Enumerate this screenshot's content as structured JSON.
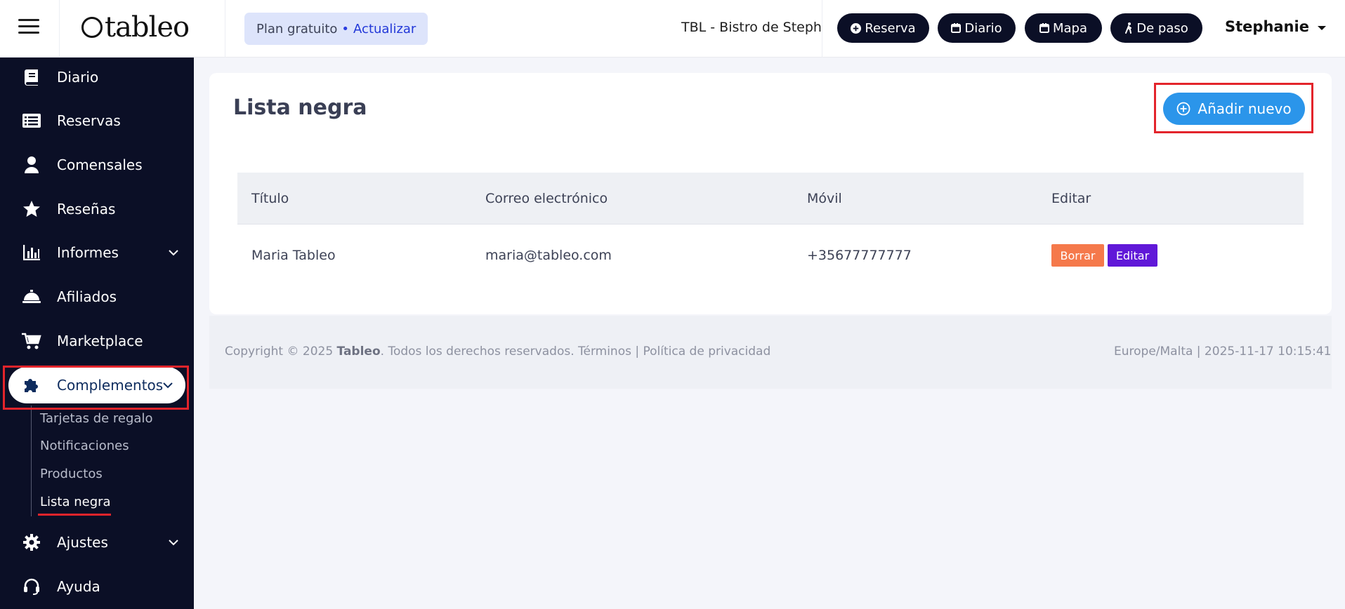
{
  "header": {
    "logo_text": "tableo",
    "plan": {
      "label": "Plan gratuito",
      "separator": "•",
      "upgrade_link": "Actualizar"
    },
    "restaurant": "TBL - Bistro de Steph",
    "quick_actions": [
      {
        "label": "Reserva",
        "icon": "plus-circle-icon"
      },
      {
        "label": "Diario",
        "icon": "calendar-icon"
      },
      {
        "label": "Mapa",
        "icon": "calendar-icon"
      },
      {
        "label": "De paso",
        "icon": "walking-icon"
      }
    ],
    "user": "Stephanie"
  },
  "sidebar": {
    "items": [
      {
        "label": "Diario",
        "icon": "book-icon"
      },
      {
        "label": "Reservas",
        "icon": "list-icon"
      },
      {
        "label": "Comensales",
        "icon": "user-icon"
      },
      {
        "label": "Reseñas",
        "icon": "star-icon"
      },
      {
        "label": "Informes",
        "icon": "bar-chart-icon"
      },
      {
        "label": "Afiliados",
        "icon": "bell-service-icon"
      },
      {
        "label": "Marketplace",
        "icon": "cart-icon"
      },
      {
        "label": "Complementos",
        "icon": "puzzle-icon"
      },
      {
        "label": "Ajustes",
        "icon": "gear-icon"
      },
      {
        "label": "Ayuda",
        "icon": "headset-icon"
      }
    ],
    "submenu": [
      "Tarjetas de regalo",
      "Notificaciones",
      "Productos",
      "Lista negra"
    ]
  },
  "main": {
    "title": "Lista negra",
    "add_button": "Añadir nuevo",
    "table": {
      "headers": [
        "Título",
        "Correo electrónico",
        "Móvil",
        "Editar"
      ],
      "rows": [
        {
          "title": "Maria Tableo",
          "email": "maria@tableo.com",
          "mobile": "+35677777777",
          "delete_label": "Borrar",
          "edit_label": "Editar"
        }
      ]
    }
  },
  "footer": {
    "copyright_prefix": "Copyright © 2025",
    "brand": "Tableo",
    "copyright_suffix": ". Todos los derechos reservados. Términos | Política de privacidad",
    "timezone_time": "Europe/Malta | 2025-11-17 10:15:41"
  },
  "colors": {
    "sidebar_bg": "#0b0f26",
    "accent_blue": "#2b95ea",
    "delete_orange": "#f5794b",
    "edit_purple": "#6018d8",
    "highlight_red": "#e3242b"
  }
}
